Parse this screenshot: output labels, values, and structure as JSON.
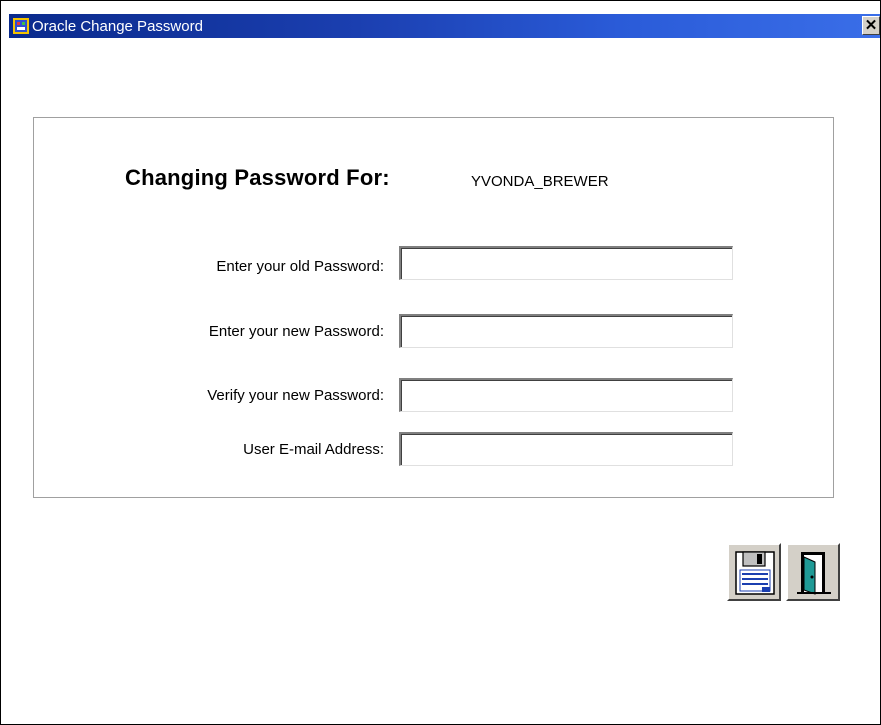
{
  "window": {
    "title": "Oracle Change Password",
    "close_glyph": "✕"
  },
  "form": {
    "header_label": "Changing Password For:",
    "username": "YVONDA_BREWER",
    "fields": [
      {
        "label": "Enter your old Password:",
        "value": ""
      },
      {
        "label": "Enter your new Password:",
        "value": ""
      },
      {
        "label": "Verify your new Password:",
        "value": ""
      },
      {
        "label": "User E-mail Address:",
        "value": ""
      }
    ]
  },
  "toolbar": {
    "save_icon": "floppy-disk-icon",
    "exit_icon": "exit-door-icon"
  },
  "colors": {
    "titlebar_start": "#0a2a8c",
    "titlebar_end": "#3a6ee8",
    "button_face": "#d4d0c8"
  }
}
